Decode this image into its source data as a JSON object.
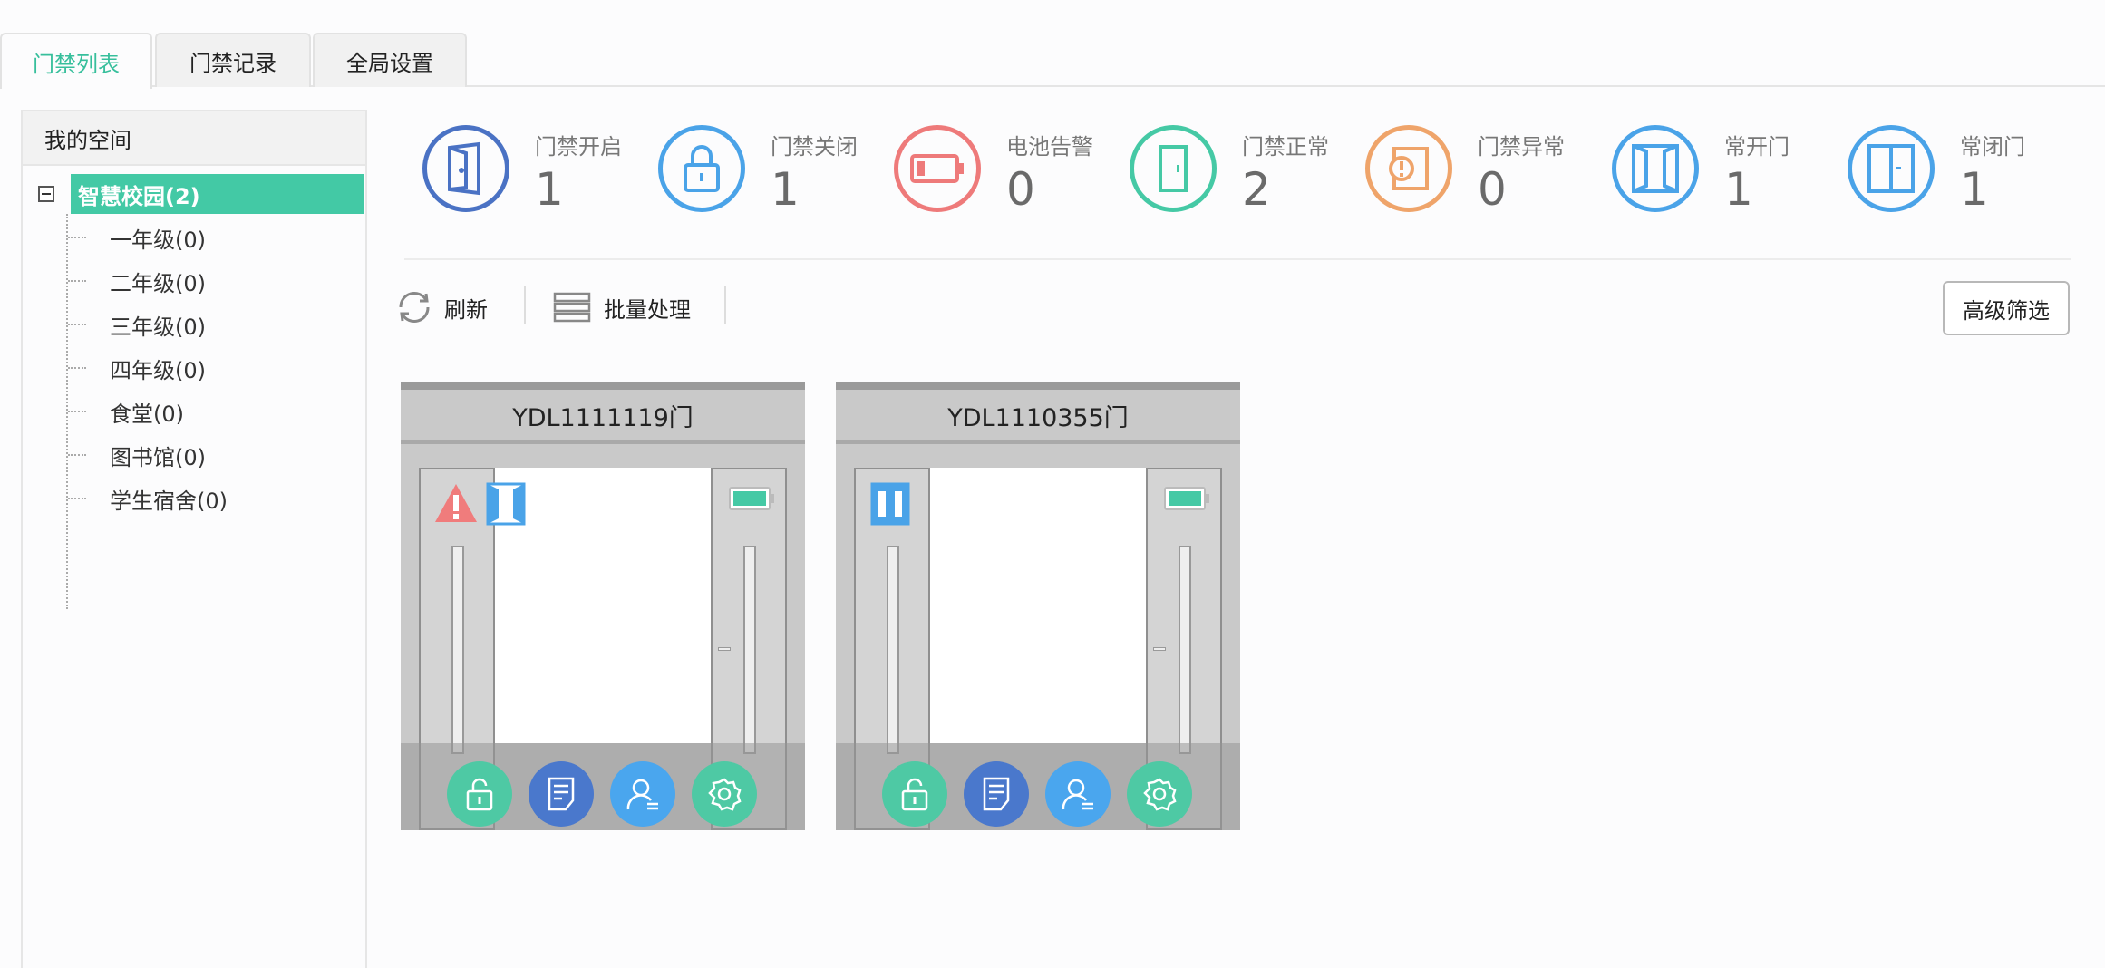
{
  "tabs": [
    {
      "label": "门禁列表",
      "active": true
    },
    {
      "label": "门禁记录",
      "active": false
    },
    {
      "label": "全局设置",
      "active": false
    }
  ],
  "sidebar": {
    "title": "我的空间",
    "root": "智慧校园(2)",
    "children": [
      "一年级(0)",
      "二年级(0)",
      "三年级(0)",
      "四年级(0)",
      "食堂(0)",
      "图书馆(0)",
      "学生宿舍(0)"
    ]
  },
  "stats": [
    {
      "label": "门禁开启",
      "value": "1",
      "color": "#4a72c4",
      "icon": "door-open-icon"
    },
    {
      "label": "门禁关闭",
      "value": "1",
      "color": "#4aa3e8",
      "icon": "lock-icon"
    },
    {
      "label": "电池告警",
      "value": "0",
      "color": "#ee7a7a",
      "icon": "battery-low-icon"
    },
    {
      "label": "门禁正常",
      "value": "2",
      "color": "#45c9a5",
      "icon": "door-normal-icon"
    },
    {
      "label": "门禁异常",
      "value": "0",
      "color": "#efa46a",
      "icon": "door-alert-icon"
    },
    {
      "label": "常开门",
      "value": "1",
      "color": "#4aa3e8",
      "icon": "door-always-open-icon"
    },
    {
      "label": "常闭门",
      "value": "1",
      "color": "#4aa3e8",
      "icon": "door-always-closed-icon"
    }
  ],
  "toolbar": {
    "refresh": "刷新",
    "batch": "批量处理",
    "advanced_filter": "高级筛选"
  },
  "doors": [
    {
      "name": "YDL1111119门",
      "alert": true,
      "status_icon": "door-always-open-icon"
    },
    {
      "name": "YDL1110355门",
      "alert": false,
      "status_icon": "door-always-closed-icon"
    }
  ],
  "colors": {
    "accent": "#43c9a5",
    "unlock_btn": "#4ec9a4",
    "record_btn": "#4a78cc",
    "user_btn": "#4aa6ee",
    "settings_btn": "#4ec9a4",
    "battery": "#45c9a5",
    "alert": "#f07c7c"
  }
}
